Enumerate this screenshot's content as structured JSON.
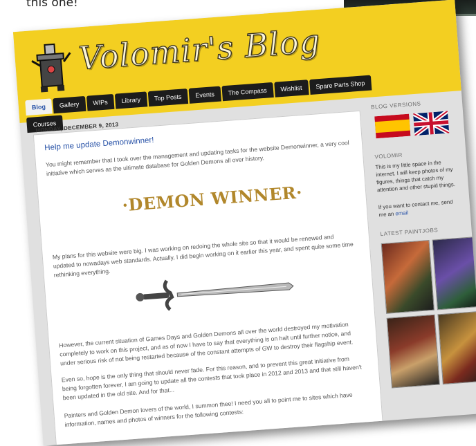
{
  "intro_text": "this one!",
  "blog": {
    "title": "Volomir's Blog"
  },
  "tabs": [
    {
      "label": "Blog"
    },
    {
      "label": "Gallery"
    },
    {
      "label": "WIPs"
    },
    {
      "label": "Library"
    },
    {
      "label": "Top Posts"
    },
    {
      "label": "Events"
    },
    {
      "label": "The Compass"
    },
    {
      "label": "Wishlist"
    },
    {
      "label": "Spare Parts Shop"
    },
    {
      "label": "Courses"
    }
  ],
  "post": {
    "date": "MONDAY, DECEMBER 9, 2013",
    "title": "Help me update Demonwinner!",
    "p1": "You might remember that I took over the management and updating tasks for the website Demonwinner, a very cool initiative which serves as the ultimate database for Golden Demons all over history.",
    "banner": "·DEMON WINNER·",
    "p2": "My plans for this website were big. I was working on redoing the whole site so that it would be renewed and updated to nowadays web standards. Actually, I did begin working on it earlier this year, and spent quite some time rethinking everything.",
    "p3": "However, the current situation of Games Days and Golden Demons all over the world destroyed my motivation completely to work on this project, and as of now I have to say that everything is on halt until further notice, and under serious risk of not being restarted because of the constant attempts of GW to destroy their flagship event.",
    "p4": "Even so, hope is the only thing that should never fade. For this reason, and to prevent this great initiative from being forgotten forever, I am going to update all the contests that took place in 2012 and 2013 and that still haven't been updated in the old site. And for that...",
    "p5": "Painters and Golden Demon lovers of the world, I summon thee! I need you all to point me to sites which have information, names and photos of winners for the following contests:"
  },
  "sidebar": {
    "versions_heading": "BLOG VERSIONS",
    "about_heading": "VOLOMIR",
    "about_text": "This is my little space in the internet. I will keep photos of my figures, things that catch my attention and other stupid things.",
    "contact_text": "If you want to contact me, send me an ",
    "contact_link": "email",
    "paintjobs_heading": "LATEST PAINTJOBS"
  },
  "colors": {
    "header_yellow": "#f3cf21",
    "link_blue": "#2a54a8",
    "nav_black": "#1c1c1c"
  }
}
